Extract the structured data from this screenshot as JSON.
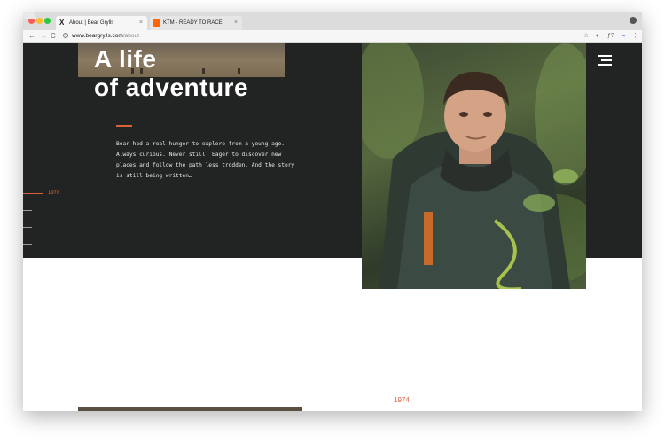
{
  "browser": {
    "tabs": [
      {
        "title": "About | Bear Grylls",
        "favicon_glyph": "X"
      },
      {
        "title": "KTM - READY TO RACE",
        "favicon_glyph": "K"
      }
    ],
    "close_glyph": "×",
    "nav": {
      "back": "←",
      "forward": "→",
      "reload": "C"
    },
    "url_host": "www.beargrylls.com",
    "url_path": "/about",
    "toolbar_icons": {
      "star": "☆",
      "shield": "◐",
      "script": "ƒ?",
      "ext": "↝",
      "menu": "⋮"
    }
  },
  "hero": {
    "title_line1": "A life",
    "title_line2": "of adventure",
    "body": "Bear had a real hunger to explore from a young age. Always curious. Never still. Eager to discover new places and follow the path less trodden. And the story is still being written…",
    "side_year": "1978"
  },
  "timeline": {
    "year": "1974"
  },
  "colors": {
    "accent": "#d9623a",
    "dark": "#222323",
    "ktm_orange": "#ff6600"
  }
}
